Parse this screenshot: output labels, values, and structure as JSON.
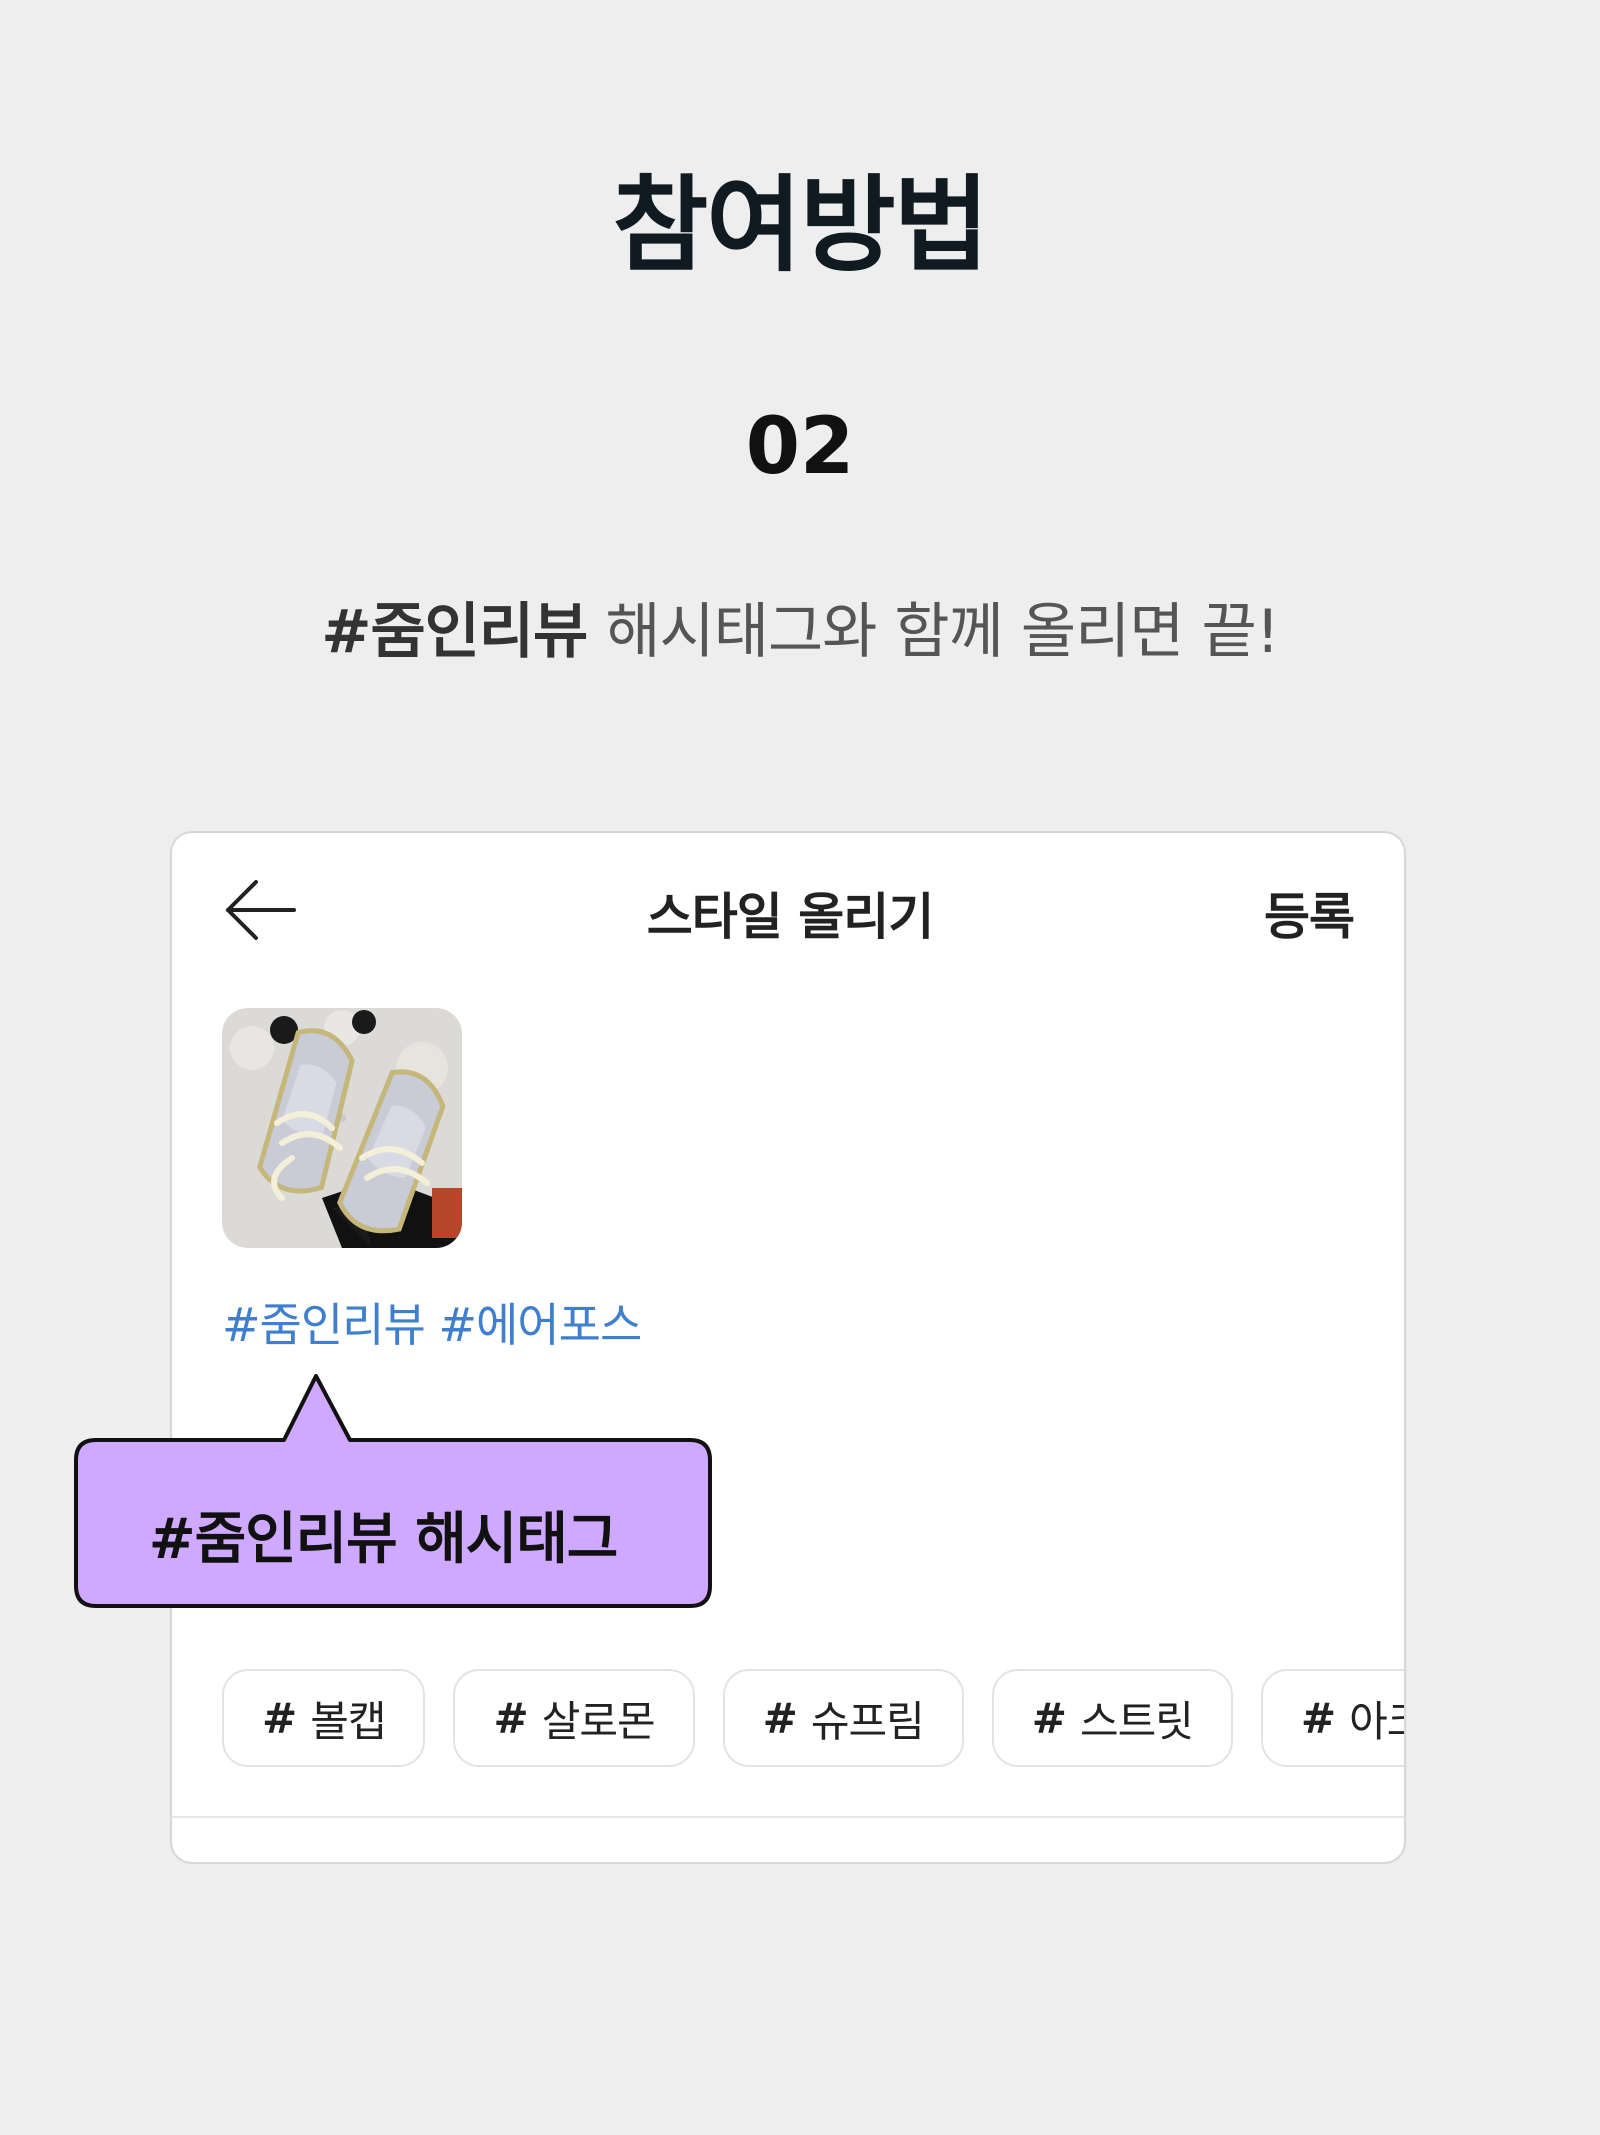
{
  "header": {
    "title": "참여방법",
    "step_number": "02"
  },
  "instruction": {
    "hashtag": "#줌인리뷰",
    "text": " 해시태그와 함께 올리면 끝!"
  },
  "card": {
    "back_icon": "arrow-left-icon",
    "title": "스타일 올리기",
    "submit_label": "등록",
    "photo_alt": "sneakers photo",
    "hashtags_text": "#줌인리뷰 #에어포스",
    "tag_chips": [
      {
        "hash": "#",
        "label": "볼캡"
      },
      {
        "hash": "#",
        "label": "살로몬"
      },
      {
        "hash": "#",
        "label": "슈프림"
      },
      {
        "hash": "#",
        "label": "스트릿"
      },
      {
        "hash": "#",
        "label": "아크테"
      }
    ]
  },
  "callout": {
    "text": "#줌인리뷰 해시태그",
    "fill_color": "#cfa8ff",
    "border_color": "#111111"
  },
  "colors": {
    "background": "#eeeeee",
    "hashtag_link": "#3f7fce"
  }
}
